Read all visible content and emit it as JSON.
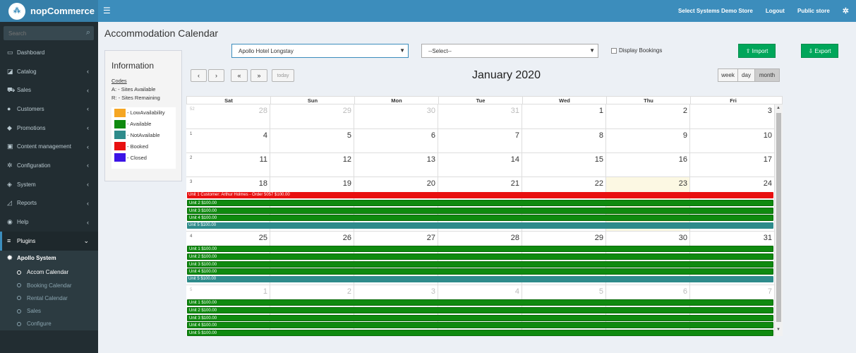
{
  "header": {
    "logo_text": "nopCommerce",
    "store_link": "Select Systems Demo Store",
    "logout": "Logout",
    "public_store": "Public store"
  },
  "sidebar": {
    "search_placeholder": "Search",
    "items": [
      {
        "label": "Dashboard",
        "icon": "dashboard-icon",
        "glyph": "▭",
        "chevron": false
      },
      {
        "label": "Catalog",
        "icon": "catalog-icon",
        "glyph": "◪",
        "chevron": true
      },
      {
        "label": "Sales",
        "icon": "cart-icon",
        "glyph": "⛟",
        "chevron": true
      },
      {
        "label": "Customers",
        "icon": "user-icon",
        "glyph": "●",
        "chevron": true
      },
      {
        "label": "Promotions",
        "icon": "tag-icon",
        "glyph": "◆",
        "chevron": true
      },
      {
        "label": "Content management",
        "icon": "cubes-icon",
        "glyph": "▣",
        "chevron": true
      },
      {
        "label": "Configuration",
        "icon": "cogs-icon",
        "glyph": "✲",
        "chevron": true
      },
      {
        "label": "System",
        "icon": "cube-icon",
        "glyph": "◈",
        "chevron": true
      },
      {
        "label": "Reports",
        "icon": "chart-icon",
        "glyph": "◿",
        "chevron": true
      },
      {
        "label": "Help",
        "icon": "help-icon",
        "glyph": "◉",
        "chevron": true
      },
      {
        "label": "Plugins",
        "icon": "bars-icon",
        "glyph": "≡",
        "chevron": true,
        "active": true
      }
    ],
    "plugin_group": "Apollo System",
    "plugin_items": [
      {
        "label": "Accom Calendar",
        "current": true
      },
      {
        "label": "Booking Calendar",
        "current": false
      },
      {
        "label": "Rental Calendar",
        "current": false
      },
      {
        "label": "Sales",
        "current": false
      },
      {
        "label": "Configure",
        "current": false
      }
    ]
  },
  "page": {
    "title": "Accommodation Calendar"
  },
  "info": {
    "title": "Information",
    "codes_label": "Codes",
    "code_a": "A: - Sites Available",
    "code_r": "R: - Sites Remaining",
    "legend": [
      {
        "label": "- LowAvailability",
        "color": "#f5a623"
      },
      {
        "label": "- Available",
        "color": "#0f8a0f"
      },
      {
        "label": "- NotAvailable",
        "color": "#2e8b8b"
      },
      {
        "label": "- Booked",
        "color": "#e81010"
      },
      {
        "label": "- Closed",
        "color": "#3c14e6"
      }
    ]
  },
  "filters": {
    "hotel_select": "Apollo Hotel Longstay",
    "second_select": "--Select--",
    "display_bookings": "Display Bookings",
    "import_label": "Import",
    "export_label": "Export"
  },
  "calendar": {
    "title": "January 2020",
    "prev": "‹",
    "next": "›",
    "prev_year": "«",
    "next_year": "»",
    "today": "today",
    "views": [
      "week",
      "day",
      "month"
    ],
    "active_view": "month",
    "days_of_week": [
      "Sat",
      "Sun",
      "Mon",
      "Tue",
      "Wed",
      "Thu",
      "Fri"
    ],
    "weeks": [
      {
        "wk": "52",
        "other_wk": true,
        "days": [
          [
            28,
            true
          ],
          [
            29,
            true
          ],
          [
            30,
            true
          ],
          [
            31,
            true
          ],
          [
            1,
            false
          ],
          [
            2,
            false
          ],
          [
            3,
            false
          ]
        ],
        "events": []
      },
      {
        "wk": "1",
        "other_wk": false,
        "days": [
          [
            4,
            false
          ],
          [
            5,
            false
          ],
          [
            6,
            false
          ],
          [
            7,
            false
          ],
          [
            8,
            false
          ],
          [
            9,
            false
          ],
          [
            10,
            false
          ]
        ],
        "events": []
      },
      {
        "wk": "2",
        "other_wk": false,
        "days": [
          [
            11,
            false
          ],
          [
            12,
            false
          ],
          [
            13,
            false
          ],
          [
            14,
            false
          ],
          [
            15,
            false
          ],
          [
            16,
            false
          ],
          [
            17,
            false
          ]
        ],
        "events": []
      },
      {
        "wk": "3",
        "other_wk": false,
        "today_index": 5,
        "days": [
          [
            18,
            false
          ],
          [
            19,
            false
          ],
          [
            20,
            false
          ],
          [
            21,
            false
          ],
          [
            22,
            false
          ],
          [
            23,
            false
          ],
          [
            24,
            false
          ]
        ],
        "events": [
          {
            "text": "Unit 1 Customer: Arthur Holmes - Order 5057 $100.00",
            "status": "booked"
          },
          {
            "text": "Unit 2 $100.00",
            "status": "available"
          },
          {
            "text": "Unit 3 $100.00",
            "status": "available"
          },
          {
            "text": "Unit 4 $100.00",
            "status": "available"
          },
          {
            "text": "Unit 5 $100.00",
            "status": "notavailable"
          }
        ]
      },
      {
        "wk": "4",
        "other_wk": false,
        "days": [
          [
            25,
            false
          ],
          [
            26,
            false
          ],
          [
            27,
            false
          ],
          [
            28,
            false
          ],
          [
            29,
            false
          ],
          [
            30,
            false
          ],
          [
            31,
            false
          ]
        ],
        "events": [
          {
            "text": "Unit 1 $100.00",
            "status": "available"
          },
          {
            "text": "Unit 2 $100.00",
            "status": "available"
          },
          {
            "text": "Unit 3 $100.00",
            "status": "available"
          },
          {
            "text": "Unit 4 $100.00",
            "status": "available"
          },
          {
            "text": "Unit 5 $100.00",
            "status": "notavailable"
          }
        ]
      },
      {
        "wk": "5",
        "other_wk": true,
        "days": [
          [
            1,
            true
          ],
          [
            2,
            true
          ],
          [
            3,
            true
          ],
          [
            4,
            true
          ],
          [
            5,
            true
          ],
          [
            6,
            true
          ],
          [
            7,
            true
          ]
        ],
        "events": [
          {
            "text": "Unit 1 $100.00",
            "status": "available"
          },
          {
            "text": "Unit 2 $100.00",
            "status": "available"
          },
          {
            "text": "Unit 3 $100.00",
            "status": "available"
          },
          {
            "text": "Unit 4 $100.00",
            "status": "available"
          },
          {
            "text": "Unit 5 $100.00",
            "status": "available"
          }
        ]
      }
    ],
    "status_colors": {
      "booked": "#e81010",
      "available": "#0f8a0f",
      "notavailable": "#2e8b8b"
    }
  }
}
